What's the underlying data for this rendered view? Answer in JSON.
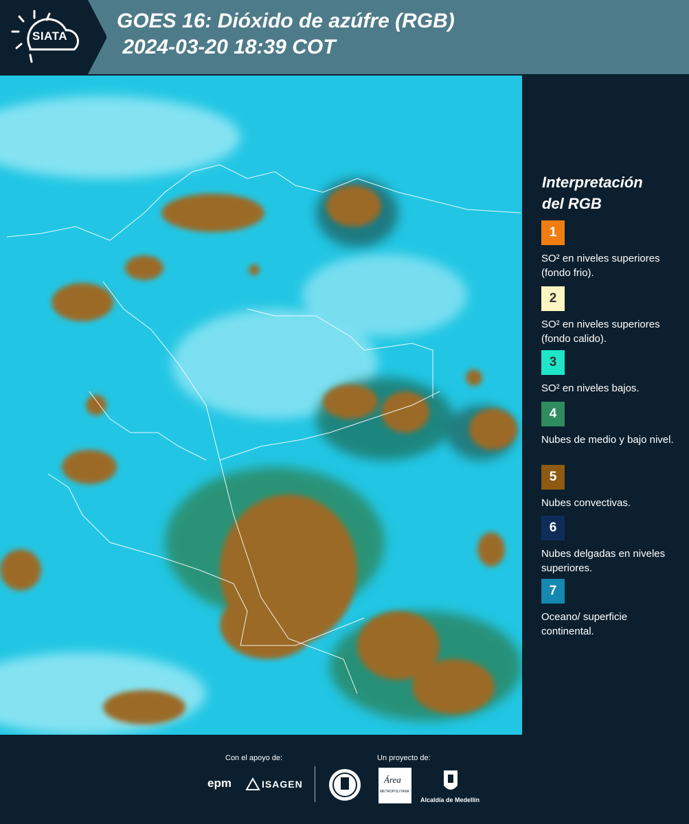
{
  "header": {
    "logo_text": "SIATA",
    "title_line1": "GOES 16: Dióxido de azúfre (RGB)",
    "title_line2": " 2024-03-20 18:39 COT"
  },
  "legend": {
    "title_line1": "Interpretación",
    "title_line2": "del RGB",
    "items": [
      {
        "number": "1",
        "color": "#f07d12",
        "text": "SO² en niveles superiores (fondo frio)."
      },
      {
        "number": "2",
        "color": "#fdf6c3",
        "text": "SO² en niveles superiores (fondo calido)."
      },
      {
        "number": "3",
        "color": "#1ee6c8",
        "text": "SO² en niveles bajos."
      },
      {
        "number": "4",
        "color": "#2e8c5e",
        "text": "Nubes de medio y bajo nivel."
      },
      {
        "number": "5",
        "color": "#8c5a10",
        "text": "Nubes convectivas."
      },
      {
        "number": "6",
        "color": "#0f2d5a",
        "text": "Nubes delgadas en niveles superiores."
      },
      {
        "number": "7",
        "color": "#1488b0",
        "text": "Oceano/ superficie continental."
      }
    ]
  },
  "footer": {
    "support_label": "Con el apoyo de:",
    "project_label": "Un proyecto de:",
    "epm_text": "epm",
    "isagen_text": "ISAGEN",
    "medellin_text": "Alcaldía de Medellín",
    "area_text": "Área",
    "area_subtext": "METROPOLITANA"
  }
}
